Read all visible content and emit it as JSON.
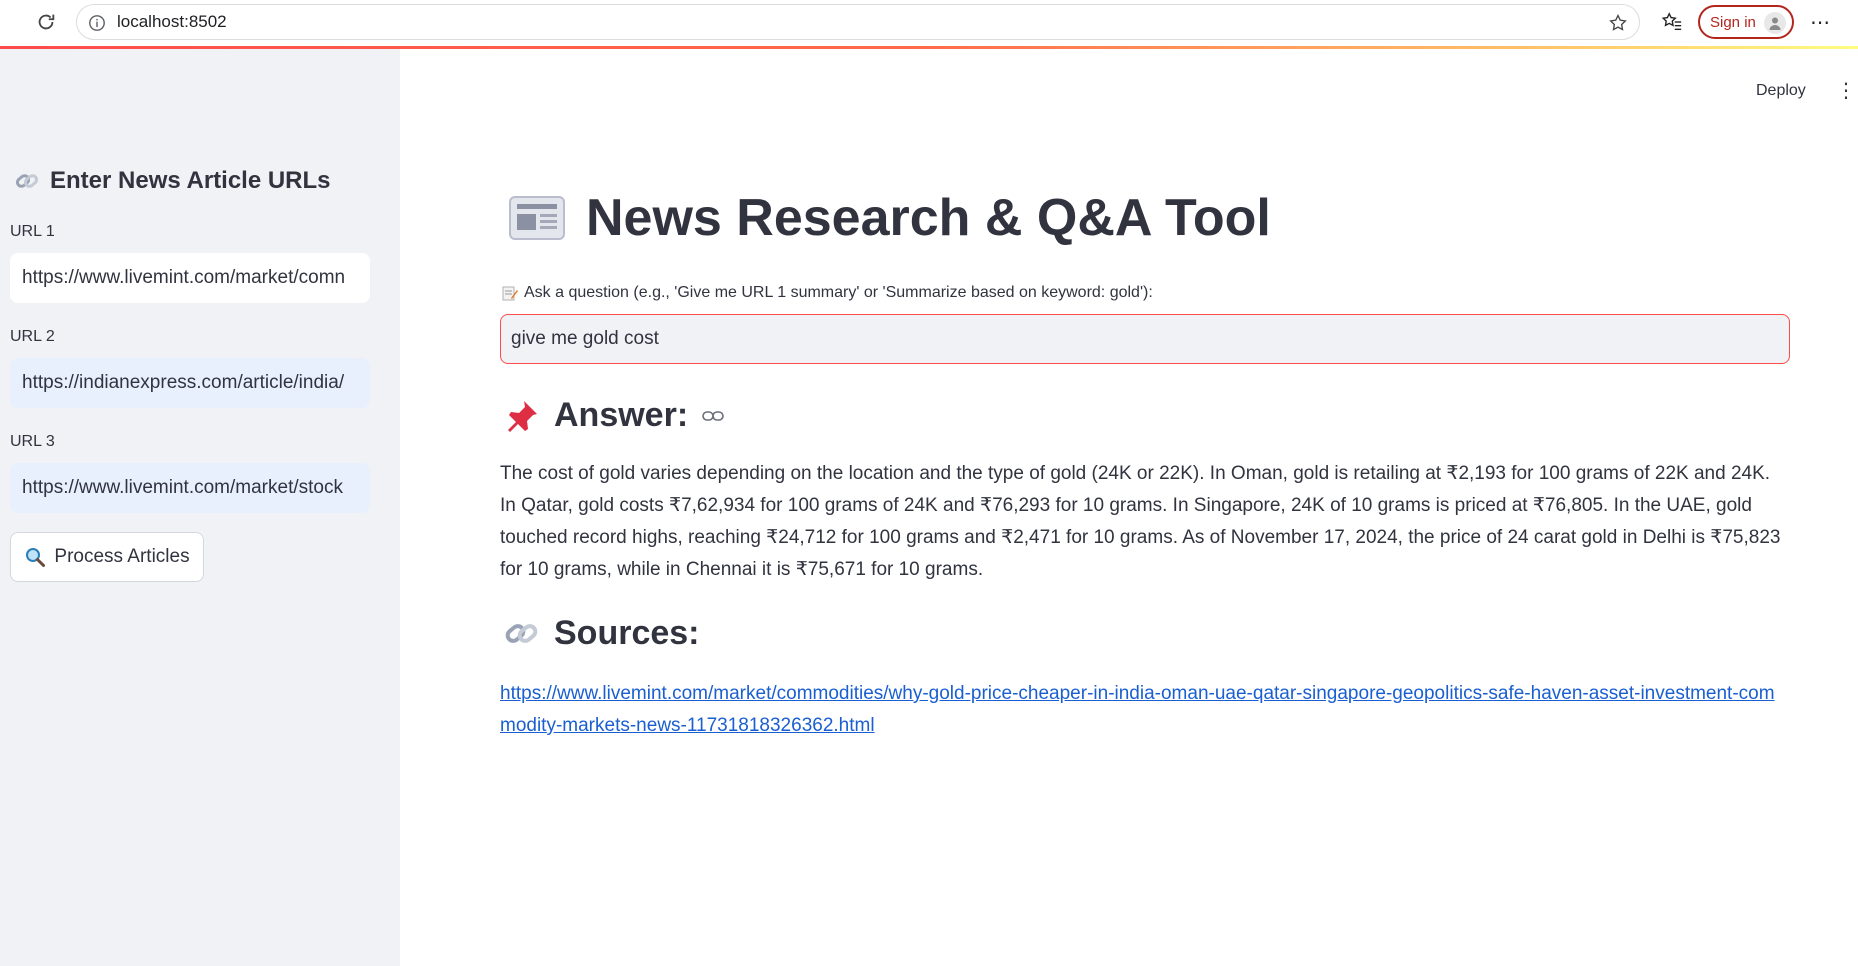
{
  "browser": {
    "url": "localhost:8502",
    "signin_label": "Sign in"
  },
  "sidebar": {
    "heading": "Enter News Article URLs",
    "heading_icon": "link-icon",
    "urls": [
      {
        "label": "URL 1",
        "value": "https://www.livemint.com/market/comn"
      },
      {
        "label": "URL 2",
        "value": "https://indianexpress.com/article/india/"
      },
      {
        "label": "URL 3",
        "value": "https://www.livemint.com/market/stock"
      }
    ],
    "process_button": "Process Articles",
    "process_icon": "magnifier-icon"
  },
  "header": {
    "deploy_label": "Deploy"
  },
  "main": {
    "title": "News Research & Q&A Tool",
    "title_icon": "newspaper-icon",
    "ask_label": "Ask a question (e.g., 'Give me URL 1 summary' or 'Summarize based on keyword: gold'):",
    "question_value": "give me gold cost",
    "answer_heading": "Answer:",
    "answer_text": "The cost of gold varies depending on the location and the type of gold (24K or 22K). In Oman, gold is retailing at ₹2,193 for 100 grams of 22K and 24K. In Qatar, gold costs ₹7,62,934 for 100 grams of 24K and ₹76,293 for 10 grams. In Singapore, 24K of 10 grams is priced at ₹76,805. In the UAE, gold touched record highs, reaching ₹24,712 for 100 grams and ₹2,471 for 10 grams. As of November 17, 2024, the price of 24 carat gold in Delhi is ₹75,823 for 10 grams, while in Chennai it is ₹75,671 for 10 grams.",
    "sources_heading": "Sources:",
    "source_url": "https://www.livemint.com/market/commodities/why-gold-price-cheaper-in-india-oman-uae-qatar-singapore-geopolitics-safe-haven-asset-investment-commodity-markets-news-11731818326362.html"
  },
  "colors": {
    "accent": "#ff4b4b",
    "sidebar_bg": "#f0f2f6",
    "link": "#1a5fd1"
  }
}
